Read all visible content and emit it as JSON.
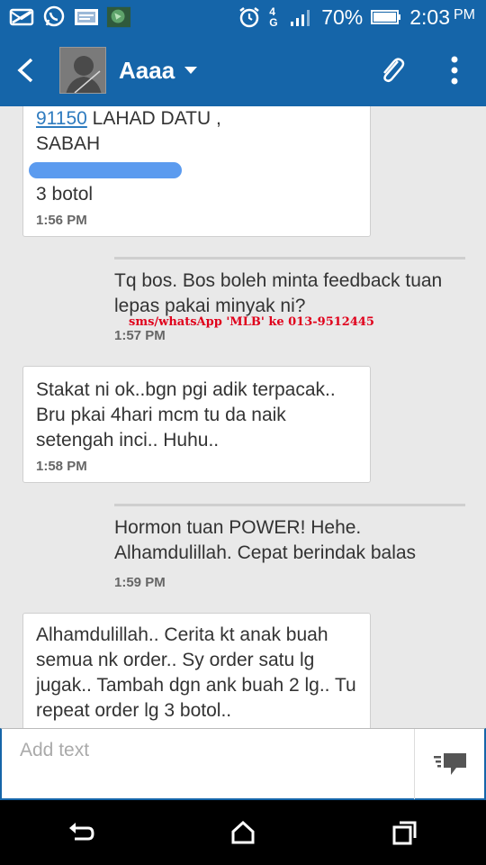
{
  "status_bar": {
    "network": "4G",
    "battery": "70%",
    "time": "2:03",
    "ampm": "PM"
  },
  "header": {
    "contact_name": "Aaaa"
  },
  "messages": [
    {
      "direction": "received",
      "lines": [
        "91150",
        " LAHAD DATU ,",
        "SABAH",
        "3 botol"
      ],
      "time": "1:56 PM"
    },
    {
      "direction": "sent",
      "text": "Tq bos. Bos boleh minta feedback tuan lepas pakai minyak ni?",
      "time": "1:57 PM"
    },
    {
      "direction": "received",
      "text": "Stakat ni ok..bgn pgi adik terpacak.. Bru pkai 4hari mcm tu da naik setengah inci.. Huhu..",
      "time": "1:58 PM"
    },
    {
      "direction": "sent",
      "text": "Hormon tuan POWER! Hehe. Alhamdulillah. Cepat berindak balas",
      "time": "1:59 PM"
    },
    {
      "direction": "received",
      "text": "Alhamdulillah.. Cerita kt anak buah semua nk order.. Sy order satu lg jugak.. Tambah dgn ank buah 2 lg.. Tu repeat order lg 3 botol.."
    }
  ],
  "watermark": "sms/whatsApp 'MLB' ke 013-9512445",
  "compose": {
    "placeholder": "Add text"
  },
  "colors": {
    "app_bar": "#1565a9",
    "bubble_bg": "#ffffff",
    "thread_bg": "#e9e9e9",
    "watermark": "#e0001b",
    "redaction": "#5b9bef"
  },
  "icons": [
    "email-icon",
    "whatsapp-icon",
    "sim-card-icon",
    "gallery-icon",
    "alarm-icon",
    "signal-icon",
    "battery-icon",
    "back-arrow-icon",
    "dropdown-icon",
    "attach-icon",
    "more-vert-icon",
    "send-icon",
    "back-nav-icon",
    "home-nav-icon",
    "recents-nav-icon"
  ]
}
